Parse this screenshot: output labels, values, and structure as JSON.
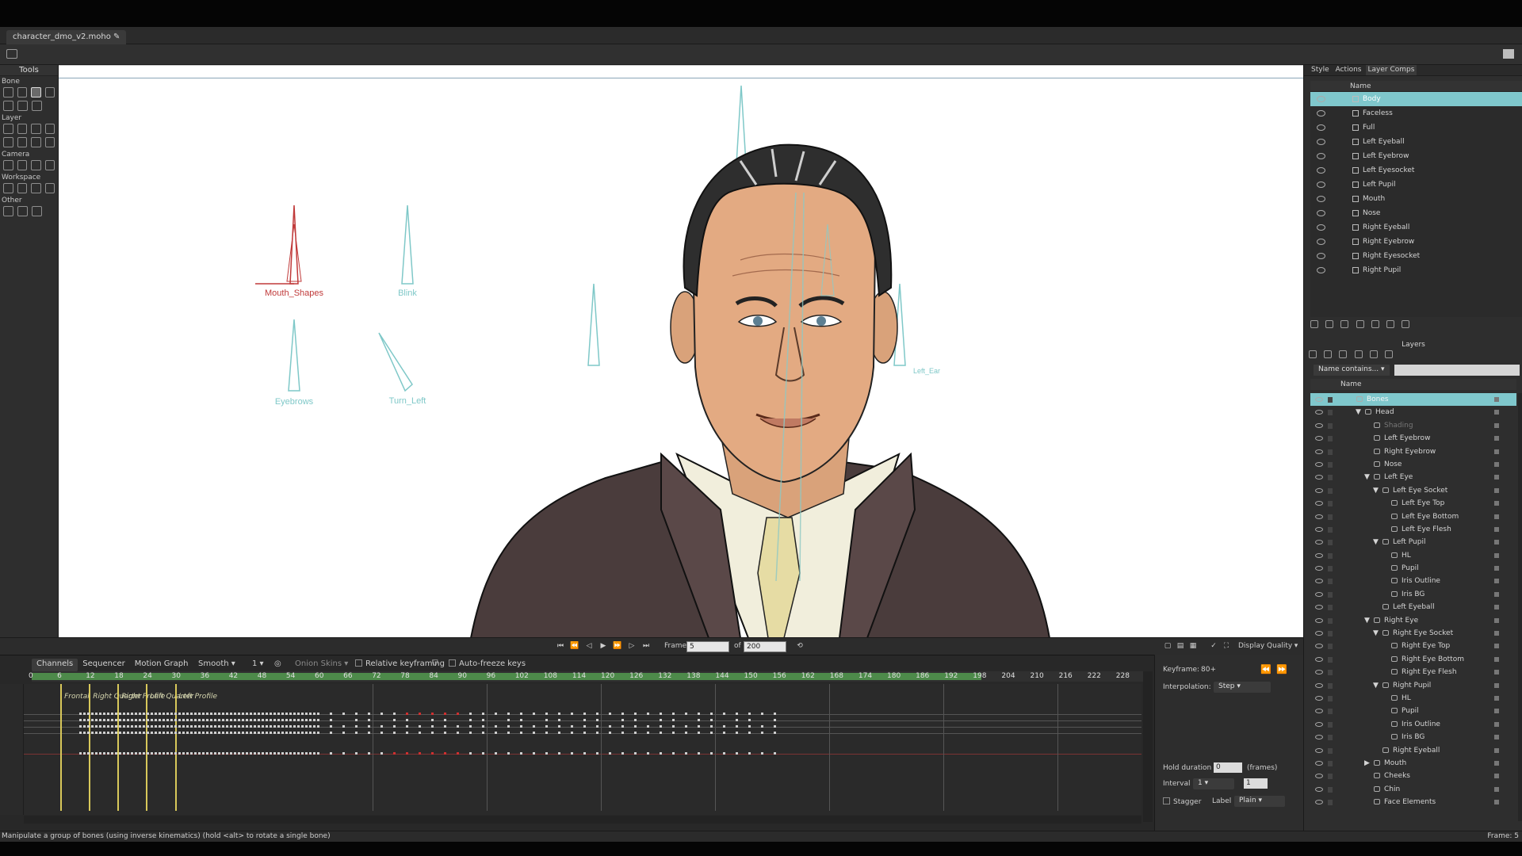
{
  "document": {
    "tab_title": "character_dmo_v2.moho ✎"
  },
  "tools": {
    "title": "Tools",
    "groups": [
      {
        "label": "Bone",
        "icons": [
          "select-bone-icon",
          "translate-bone-icon",
          "manipulate-bones-icon",
          "bone-strength-icon",
          "add-bone-icon",
          "reparent-bone-icon",
          "bone-physics-icon"
        ]
      },
      {
        "label": "Layer",
        "icons": [
          "transform-layer-icon",
          "set-origin-icon",
          "rotate-layer-icon",
          "shear-layer-icon",
          "scale-layer-icon",
          "switch-layer-icon",
          "text-icon",
          "eyedropper-icon"
        ]
      },
      {
        "label": "Camera",
        "icons": [
          "track-camera-icon",
          "zoom-camera-icon",
          "roll-camera-icon",
          "pan-tilt-camera-icon"
        ]
      },
      {
        "label": "Workspace",
        "icons": [
          "hand-icon",
          "magnify-icon",
          "rotate-workspace-icon",
          "orbit-icon"
        ]
      },
      {
        "label": "Other",
        "icons": [
          "insert-text-icon",
          "ruler-icon",
          "frame-icon"
        ]
      }
    ]
  },
  "canvas": {
    "bone_labels": [
      {
        "name": "Mouth_Shapes",
        "color": "#c03a3a"
      },
      {
        "name": "Blink",
        "color": "#7fc8c8"
      },
      {
        "name": "Eyebrows",
        "color": "#7fc8c8"
      },
      {
        "name": "Turn_Left",
        "color": "#7fc8c8"
      },
      {
        "name": "Left_Ear",
        "color": "#7fc8c8"
      }
    ]
  },
  "playback": {
    "frame_label": "Frame",
    "frame_value": "5",
    "of_label": "of",
    "total_frames": "200",
    "display_quality_label": "Display Quality"
  },
  "timeline": {
    "tabs": [
      "Channels",
      "Sequencer",
      "Motion Graph"
    ],
    "interp_dropdown": "Smooth",
    "step_value": "1",
    "onion_skins": "Onion Skins",
    "relative_keyframing": "Relative keyframing",
    "auto_freeze": "Auto-freeze keys",
    "ruler_ticks": [
      "0",
      "6",
      "12",
      "18",
      "24",
      "30",
      "36",
      "42",
      "48",
      "54",
      "60",
      "66",
      "72",
      "78",
      "84",
      "90",
      "96",
      "102",
      "108",
      "114",
      "120",
      "126",
      "132",
      "138",
      "144",
      "150",
      "156",
      "162",
      "168",
      "174",
      "180",
      "186",
      "192",
      "198",
      "204",
      "210",
      "216",
      "222",
      "228"
    ],
    "markers": [
      "Frontal",
      "Right Quarter",
      "Right Profile",
      "Left Quarter",
      "Left Profile"
    ],
    "marker_frames": [
      6,
      12,
      18,
      24,
      30
    ]
  },
  "keyframe_panel": {
    "keyframe_label": "Keyframe:",
    "keyframe_value": "80+",
    "interpolation_label": "Interpolation:",
    "interpolation_value": "Step",
    "hold_duration_label": "Hold duration",
    "hold_duration_value": "0",
    "hold_units": "(frames)",
    "interval_label": "Interval",
    "interval_value": "1",
    "interval_input": "1",
    "stagger_label": "Stagger",
    "label_label": "Label",
    "label_value": "Plain"
  },
  "right_panel": {
    "tabs": [
      "Style",
      "Actions",
      "Layer Comps"
    ],
    "comps_header": "Name",
    "comps": [
      "Body",
      "Faceless",
      "Full",
      "Left Eyeball",
      "Left Eyebrow",
      "Left Eyesocket",
      "Left Pupil",
      "Mouth",
      "Nose",
      "Right Eyeball",
      "Right Eyebrow",
      "Right Eyesocket",
      "Right Pupil"
    ],
    "layers_title": "Layers",
    "filter_label": "Name contains...",
    "layers_header": "Name",
    "layers": [
      {
        "name": "Bones",
        "indent": 0,
        "kind": "bone",
        "selected": true
      },
      {
        "name": "Head",
        "indent": 1,
        "kind": "group",
        "expanded": true
      },
      {
        "name": "Shading",
        "indent": 2,
        "kind": "vector",
        "dim": true
      },
      {
        "name": "Left Eyebrow",
        "indent": 2,
        "kind": "vector"
      },
      {
        "name": "Right Eyebrow",
        "indent": 2,
        "kind": "vector"
      },
      {
        "name": "Nose",
        "indent": 2,
        "kind": "vector"
      },
      {
        "name": "Left Eye",
        "indent": 2,
        "kind": "group",
        "expanded": true
      },
      {
        "name": "Left Eye Socket",
        "indent": 3,
        "kind": "group",
        "expanded": true
      },
      {
        "name": "Left Eye Top",
        "indent": 4,
        "kind": "vector"
      },
      {
        "name": "Left Eye Bottom",
        "indent": 4,
        "kind": "vector"
      },
      {
        "name": "Left Eye Flesh",
        "indent": 4,
        "kind": "vector"
      },
      {
        "name": "Left Pupil",
        "indent": 3,
        "kind": "group",
        "expanded": true
      },
      {
        "name": "HL",
        "indent": 4,
        "kind": "vector"
      },
      {
        "name": "Pupil",
        "indent": 4,
        "kind": "vector"
      },
      {
        "name": "Iris Outline",
        "indent": 4,
        "kind": "vector"
      },
      {
        "name": "Iris BG",
        "indent": 4,
        "kind": "vector"
      },
      {
        "name": "Left Eyeball",
        "indent": 3,
        "kind": "vector"
      },
      {
        "name": "Right Eye",
        "indent": 2,
        "kind": "group",
        "expanded": true
      },
      {
        "name": "Right Eye Socket",
        "indent": 3,
        "kind": "group",
        "expanded": true
      },
      {
        "name": "Right Eye Top",
        "indent": 4,
        "kind": "vector"
      },
      {
        "name": "Right Eye Bottom",
        "indent": 4,
        "kind": "vector"
      },
      {
        "name": "Right Eye Flesh",
        "indent": 4,
        "kind": "vector"
      },
      {
        "name": "Right Pupil",
        "indent": 3,
        "kind": "group",
        "expanded": true
      },
      {
        "name": "HL",
        "indent": 4,
        "kind": "vector"
      },
      {
        "name": "Pupil",
        "indent": 4,
        "kind": "vector"
      },
      {
        "name": "Iris Outline",
        "indent": 4,
        "kind": "vector"
      },
      {
        "name": "Iris BG",
        "indent": 4,
        "kind": "vector"
      },
      {
        "name": "Right Eyeball",
        "indent": 3,
        "kind": "vector"
      },
      {
        "name": "Mouth",
        "indent": 2,
        "kind": "switch",
        "expanded": false
      },
      {
        "name": "Cheeks",
        "indent": 2,
        "kind": "vector"
      },
      {
        "name": "Chin",
        "indent": 2,
        "kind": "vector"
      },
      {
        "name": "Face Elements",
        "indent": 2,
        "kind": "vector"
      }
    ]
  },
  "status": {
    "message": "Manipulate a group of bones (using inverse kinematics) (hold <alt> to rotate a single bone)",
    "frame": "Frame: 5"
  },
  "colors": {
    "accent_selection": "#7fc7cc",
    "timeline_range": "#4d8a4a",
    "bone_red": "#c03a3a",
    "bone_cyan": "#7fc8c8",
    "marker_yellow": "#d8c85a"
  }
}
